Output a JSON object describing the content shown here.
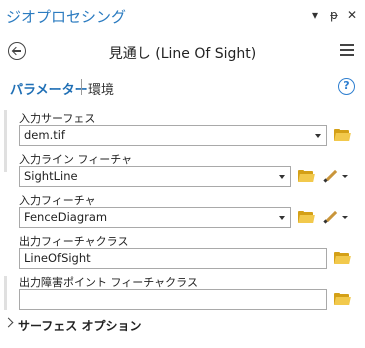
{
  "pane": {
    "title": "ジオプロセシング",
    "controls": {
      "dropdown": "▾",
      "pin": "ᵽ",
      "close": "✕"
    }
  },
  "tool": {
    "title": "見通し (Line Of Sight)"
  },
  "tabs": {
    "parameters": "パラメーター",
    "environments": "環境"
  },
  "help": "?",
  "params": {
    "surface": {
      "label": "入力サーフェス",
      "value": "dem.tif"
    },
    "line": {
      "label": "入力ライン フィーチャ",
      "value": "SightLine"
    },
    "features": {
      "label": "入力フィーチャ",
      "value": "FenceDiagram"
    },
    "output": {
      "label": "出力フィーチャクラス",
      "value": "LineOfSight"
    },
    "obstruction": {
      "label": "出力障害ポイント フィーチャクラス",
      "value": ""
    }
  },
  "section": {
    "surface_options": "サーフェス オプション"
  },
  "colors": {
    "accent": "#2b7bc0",
    "folder": "#f2c94c",
    "folder_dark": "#d4a017"
  },
  "icons": [
    "back-arrow-icon",
    "hamburger-menu-icon",
    "help-icon",
    "folder-icon",
    "pencil-icon",
    "chevron-right-icon"
  ]
}
